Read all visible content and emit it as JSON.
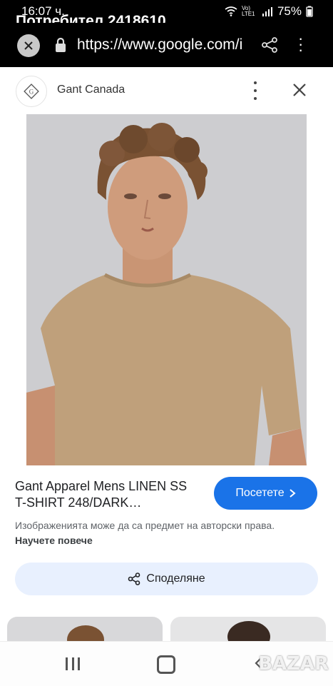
{
  "status": {
    "time": "16:07 ч.",
    "network": "Vo) LTE1",
    "battery": "75%"
  },
  "overlay_title": "Потребител 2418610",
  "browser": {
    "url": "https://www.google.com/i"
  },
  "site": {
    "name": "Gant Canada"
  },
  "result": {
    "title": "Gant Apparel Mens LINEN SS T-SHIRT 248/DARK…",
    "visit_label": "Посетете",
    "copyright_text": "Изображенията може да са предмет на авторски права.",
    "learn_more": "Научете повече",
    "share_label": "Споделяне"
  },
  "watermark": "BAZAR",
  "colors": {
    "accent": "#1a73e8",
    "share_bg": "#e8f0fe"
  }
}
